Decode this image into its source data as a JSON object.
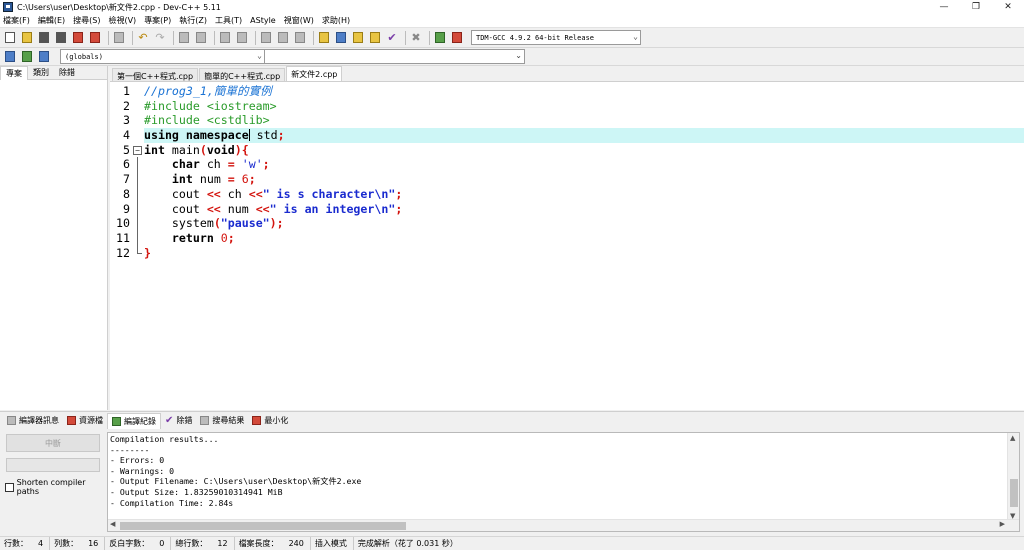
{
  "window": {
    "title": "C:\\Users\\user\\Desktop\\新文件2.cpp - Dev-C++ 5.11",
    "controls": {
      "minimize": "—",
      "maximize": "❐",
      "close": "✕"
    }
  },
  "menu": [
    "檔案(F)",
    "編輯(E)",
    "搜尋(S)",
    "檢視(V)",
    "專案(P)",
    "執行(Z)",
    "工具(T)",
    "AStyle",
    "視窗(W)",
    "求助(H)"
  ],
  "toolbar": {
    "compiler": "TDM-GCC 4.9.2 64-bit Release",
    "scope": "(globals)",
    "member": ""
  },
  "left_panel": {
    "tabs": [
      "專案",
      "類別",
      "除錯"
    ],
    "active_tab": 0
  },
  "editor": {
    "tabs": [
      "第一個C++程式.cpp",
      "簡單的C++程式.cpp",
      "新文件2.cpp"
    ],
    "active_tab": 2,
    "current_line": 4,
    "lines": [
      {
        "num": "1",
        "tokens": [
          {
            "t": "//prog3_1,簡單的實例",
            "c": "comment"
          }
        ]
      },
      {
        "num": "2",
        "tokens": [
          {
            "t": "#include <iostream>",
            "c": "pre"
          }
        ]
      },
      {
        "num": "3",
        "tokens": [
          {
            "t": "#include <cstdlib>",
            "c": "pre"
          }
        ]
      },
      {
        "num": "4",
        "tokens": [
          {
            "t": "using namespace",
            "c": "kw"
          },
          {
            "t": " std",
            "c": "id"
          },
          {
            "t": ";",
            "c": "sym"
          }
        ]
      },
      {
        "num": "5",
        "tokens": [
          {
            "t": "int",
            "c": "kw"
          },
          {
            "t": " main",
            "c": "id"
          },
          {
            "t": "(",
            "c": "sym"
          },
          {
            "t": "void",
            "c": "kw"
          },
          {
            "t": "){",
            "c": "sym"
          }
        ]
      },
      {
        "num": "6",
        "tokens": [
          {
            "t": "    ",
            "c": "id"
          },
          {
            "t": "char",
            "c": "kw"
          },
          {
            "t": " ch ",
            "c": "id"
          },
          {
            "t": "=",
            "c": "sym"
          },
          {
            "t": " 'w'",
            "c": "char"
          },
          {
            "t": ";",
            "c": "sym"
          }
        ]
      },
      {
        "num": "7",
        "tokens": [
          {
            "t": "    ",
            "c": "id"
          },
          {
            "t": "int",
            "c": "kw"
          },
          {
            "t": " num ",
            "c": "id"
          },
          {
            "t": "=",
            "c": "sym"
          },
          {
            "t": " 6",
            "c": "num"
          },
          {
            "t": ";",
            "c": "sym"
          }
        ]
      },
      {
        "num": "8",
        "tokens": [
          {
            "t": "    cout ",
            "c": "id"
          },
          {
            "t": "<<",
            "c": "sym"
          },
          {
            "t": " ch ",
            "c": "id"
          },
          {
            "t": "<<",
            "c": "sym"
          },
          {
            "t": "\" is s character\\n\"",
            "c": "str"
          },
          {
            "t": ";",
            "c": "sym"
          }
        ]
      },
      {
        "num": "9",
        "tokens": [
          {
            "t": "    cout ",
            "c": "id"
          },
          {
            "t": "<<",
            "c": "sym"
          },
          {
            "t": " num ",
            "c": "id"
          },
          {
            "t": "<<",
            "c": "sym"
          },
          {
            "t": "\" is an integer\\n\"",
            "c": "str"
          },
          {
            "t": ";",
            "c": "sym"
          }
        ]
      },
      {
        "num": "10",
        "tokens": [
          {
            "t": "    system",
            "c": "id"
          },
          {
            "t": "(",
            "c": "sym"
          },
          {
            "t": "\"pause\"",
            "c": "str"
          },
          {
            "t": ");",
            "c": "sym"
          }
        ]
      },
      {
        "num": "11",
        "tokens": [
          {
            "t": "    ",
            "c": "id"
          },
          {
            "t": "return",
            "c": "kw"
          },
          {
            "t": " 0",
            "c": "num"
          },
          {
            "t": ";",
            "c": "sym"
          }
        ]
      },
      {
        "num": "12",
        "tokens": [
          {
            "t": "}",
            "c": "sym"
          }
        ]
      }
    ]
  },
  "bottom_tabs": [
    "編譯器訊息",
    "資源檔",
    "編譯紀錄",
    "除錯",
    "搜尋結果",
    "最小化"
  ],
  "bottom_active_tab": 2,
  "compile_panel": {
    "abort_label": "中斷",
    "progress": 0,
    "shorten_label": "Shorten compiler paths",
    "log_lines": [
      "Compilation results...",
      "--------",
      "- Errors: 0",
      "- Warnings: 0",
      "- Output Filename: C:\\Users\\user\\Desktop\\新文件2.exe",
      "- Output Size: 1.83259010314941 MiB",
      "- Compilation Time: 2.84s"
    ]
  },
  "status": {
    "line_label": "行數：",
    "line_value": "4",
    "col_label": "列數：",
    "col_value": "16",
    "sel_label": "反白字數：",
    "sel_value": "0",
    "total_label": "總行數：",
    "total_value": "12",
    "len_label": "檔案長度：",
    "len_value": "240",
    "mode": "插入模式",
    "parse": "完成解析（花了 0.031 秒）"
  },
  "colors": {
    "current_line": "#cdf6f6",
    "comment": "#1b73d4",
    "preprocessor": "#2a9b2a",
    "symbol": "#d3140e",
    "string": "#1a2bcf"
  }
}
